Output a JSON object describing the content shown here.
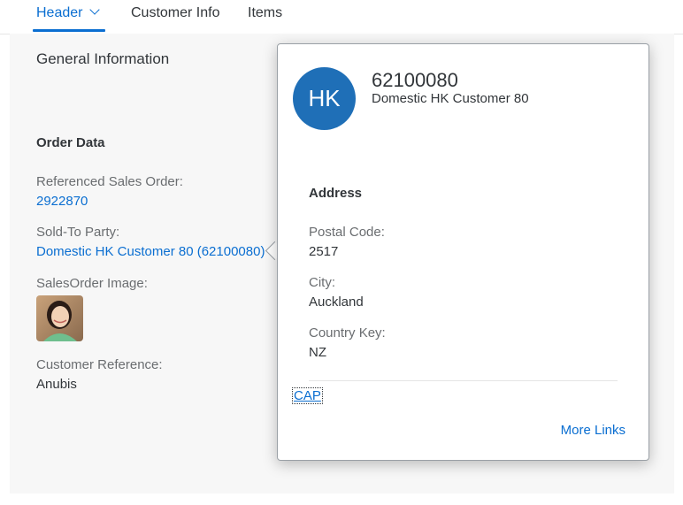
{
  "tabs": [
    {
      "label": "Header",
      "selected": true
    },
    {
      "label": "Customer Info",
      "selected": false
    },
    {
      "label": "Items",
      "selected": false
    }
  ],
  "general": {
    "title": "General Information"
  },
  "order_data": {
    "title": "Order Data",
    "referenced_sales_order": {
      "label": "Referenced Sales Order:",
      "value": "2922870"
    },
    "sold_to_party": {
      "label": "Sold-To Party:",
      "value": "Domestic HK Customer 80 (62100080)"
    },
    "sales_order_image": {
      "label": "SalesOrder Image:"
    },
    "customer_reference": {
      "label": "Customer Reference:",
      "value": "Anubis"
    }
  },
  "popover": {
    "avatar_initials": "HK",
    "id": "62100080",
    "name": "Domestic HK Customer 80",
    "address_title": "Address",
    "postal_code": {
      "label": "Postal Code:",
      "value": "2517"
    },
    "city": {
      "label": "City:",
      "value": "Auckland"
    },
    "country_key": {
      "label": "Country Key:",
      "value": "NZ"
    },
    "cap_link": "CAP",
    "more_links": "More Links"
  },
  "colors": {
    "accent": "#0a6ed1",
    "avatar_bg": "#1f6fb7",
    "page_bg": "#f7f7f7"
  }
}
